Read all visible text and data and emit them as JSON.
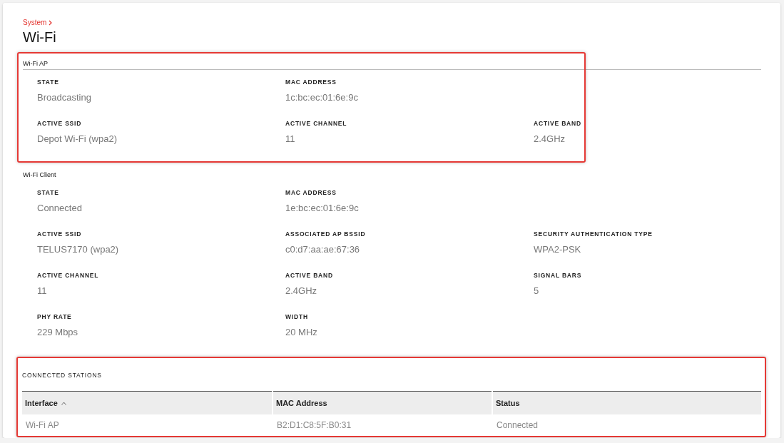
{
  "breadcrumb": {
    "label": "System"
  },
  "title": "Wi-Fi",
  "sections": [
    {
      "title": "Wi-Fi AP",
      "highlighted": true,
      "rows": [
        [
          {
            "label": "STATE",
            "value": "Broadcasting"
          },
          {
            "label": "MAC ADDRESS",
            "value": "1c:bc:ec:01:6e:9c"
          }
        ],
        [
          {
            "label": "ACTIVE SSID",
            "value": "Depot Wi-Fi (wpa2)"
          },
          {
            "label": "ACTIVE CHANNEL",
            "value": "11"
          },
          {
            "label": "ACTIVE BAND",
            "value": "2.4GHz"
          }
        ]
      ]
    },
    {
      "title": "Wi-Fi Client",
      "highlighted": false,
      "rows": [
        [
          {
            "label": "STATE",
            "value": "Connected"
          },
          {
            "label": "MAC ADDRESS",
            "value": "1e:bc:ec:01:6e:9c"
          }
        ],
        [
          {
            "label": "ACTIVE SSID",
            "value": "TELUS7170 (wpa2)"
          },
          {
            "label": "ASSOCIATED AP BSSID",
            "value": "c0:d7:aa:ae:67:36"
          },
          {
            "label": "SECURITY AUTHENTICATION TYPE",
            "value": "WPA2-PSK"
          }
        ],
        [
          {
            "label": "ACTIVE CHANNEL",
            "value": "11"
          },
          {
            "label": "ACTIVE BAND",
            "value": "2.4GHz"
          },
          {
            "label": "SIGNAL BARS",
            "value": "5"
          }
        ],
        [
          {
            "label": "PHY RATE",
            "value": "229 Mbps"
          },
          {
            "label": "WIDTH",
            "value": "20 MHz"
          }
        ]
      ]
    }
  ],
  "stations": {
    "title": "CONNECTED STATIONS",
    "highlighted": true,
    "columns": [
      {
        "label": "Interface",
        "sorted": true
      },
      {
        "label": "MAC Address",
        "sorted": false
      },
      {
        "label": "Status",
        "sorted": false
      }
    ],
    "rows": [
      [
        "Wi-Fi AP",
        "B2:D1:C8:5F:B0:31",
        "Connected"
      ]
    ]
  }
}
